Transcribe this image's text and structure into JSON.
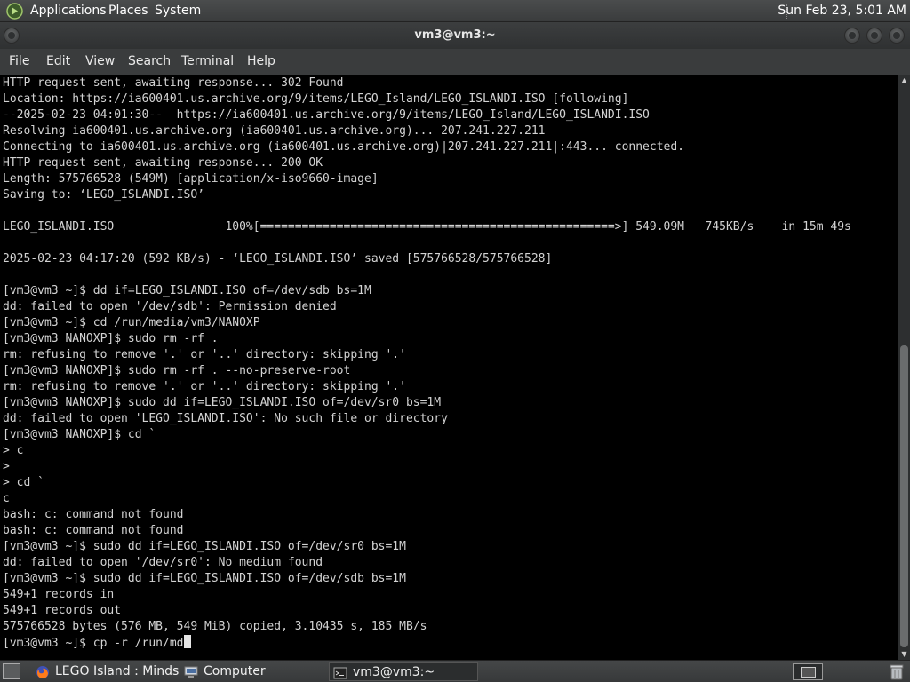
{
  "top_panel": {
    "menus": [
      "Applications",
      "Places",
      "System"
    ],
    "clock": "Sun Feb 23,  5:01 AM"
  },
  "window": {
    "title": "vm3@vm3:~"
  },
  "menubar": [
    "File",
    "Edit",
    "View",
    "Search",
    "Terminal",
    "Help"
  ],
  "terminal": {
    "lines": [
      "HTTP request sent, awaiting response... 302 Found",
      "Location: https://ia600401.us.archive.org/9/items/LEGO_Island/LEGO_ISLANDI.ISO [following]",
      "--2025-02-23 04:01:30--  https://ia600401.us.archive.org/9/items/LEGO_Island/LEGO_ISLANDI.ISO",
      "Resolving ia600401.us.archive.org (ia600401.us.archive.org)... 207.241.227.211",
      "Connecting to ia600401.us.archive.org (ia600401.us.archive.org)|207.241.227.211|:443... connected.",
      "HTTP request sent, awaiting response... 200 OK",
      "Length: 575766528 (549M) [application/x-iso9660-image]",
      "Saving to: ‘LEGO_ISLANDI.ISO’",
      "",
      "LEGO_ISLANDI.ISO                100%[===================================================>] 549.09M   745KB/s    in 15m 49s",
      "",
      "2025-02-23 04:17:20 (592 KB/s) - ‘LEGO_ISLANDI.ISO’ saved [575766528/575766528]",
      "",
      "[vm3@vm3 ~]$ dd if=LEGO_ISLANDI.ISO of=/dev/sdb bs=1M",
      "dd: failed to open '/dev/sdb': Permission denied",
      "[vm3@vm3 ~]$ cd /run/media/vm3/NANOXP",
      "[vm3@vm3 NANOXP]$ sudo rm -rf .",
      "rm: refusing to remove '.' or '..' directory: skipping '.'",
      "[vm3@vm3 NANOXP]$ sudo rm -rf . --no-preserve-root",
      "rm: refusing to remove '.' or '..' directory: skipping '.'",
      "[vm3@vm3 NANOXP]$ sudo dd if=LEGO_ISLANDI.ISO of=/dev/sr0 bs=1M",
      "dd: failed to open 'LEGO_ISLANDI.ISO': No such file or directory",
      "[vm3@vm3 NANOXP]$ cd `",
      "> c",
      ">",
      "> cd `",
      "c",
      "bash: c: command not found",
      "bash: c: command not found",
      "[vm3@vm3 ~]$ sudo dd if=LEGO_ISLANDI.ISO of=/dev/sr0 bs=1M",
      "dd: failed to open '/dev/sr0': No medium found",
      "[vm3@vm3 ~]$ sudo dd if=LEGO_ISLANDI.ISO of=/dev/sdb bs=1M",
      "549+1 records in",
      "549+1 records out",
      "575766528 bytes (576 MB, 549 MiB) copied, 3.10435 s, 185 MB/s"
    ],
    "prompt_line": "[vm3@vm3 ~]$ cp -r /run/md"
  },
  "taskbar": {
    "tasks": [
      {
        "label": "LEGO Island : Minds...",
        "icon": "firefox-icon"
      },
      {
        "label": "Computer",
        "icon": "computer-icon"
      },
      {
        "label": "vm3@vm3:~",
        "icon": "terminal-icon"
      }
    ]
  }
}
